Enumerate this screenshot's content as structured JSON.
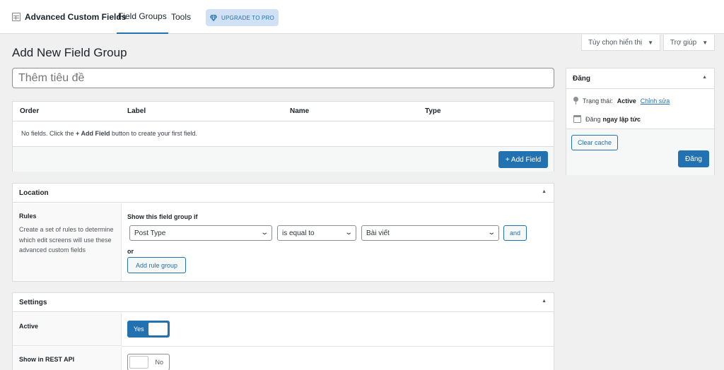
{
  "topbar": {
    "brand": "Advanced Custom Fields",
    "nav": [
      "Field Groups",
      "Tools"
    ],
    "upgrade": "UPGRADE TO PRO"
  },
  "screen_options": {
    "label": "Tùy chọn hiển thị"
  },
  "help": {
    "label": "Trợ giúp"
  },
  "page_title": "Add New Field Group",
  "title_input": {
    "placeholder": "Thêm tiêu đề"
  },
  "fields": {
    "columns": [
      "Order",
      "Label",
      "Name",
      "Type"
    ],
    "empty_prefix": "No fields. Click the",
    "empty_link": "+ Add Field",
    "empty_suffix": "button to create your first field.",
    "add_button": "+ Add Field"
  },
  "location": {
    "title": "Location",
    "rules_label": "Rules",
    "rules_desc": "Create a set of rules to determine which edit screens will use these advanced custom fields",
    "show_if": "Show this field group if",
    "param": "Post Type",
    "operator": "is equal to",
    "value": "Bài viết",
    "and_button": "and",
    "or_label": "or",
    "add_group_button": "Add rule group"
  },
  "settings": {
    "title": "Settings",
    "active_label": "Active",
    "active_value": "Yes",
    "rest_label": "Show in REST API",
    "rest_value": "No"
  },
  "publish": {
    "title": "Đăng",
    "status_label": "Trạng thái:",
    "status_value": "Active",
    "status_edit": "Chỉnh sửa",
    "publish_text": "Đăng",
    "publish_when": "ngay lập tức",
    "clear_cache": "Clear cache",
    "publish_button": "Đăng"
  },
  "colors": {
    "accent": "#2271b1",
    "background": "#f0f0f1"
  }
}
